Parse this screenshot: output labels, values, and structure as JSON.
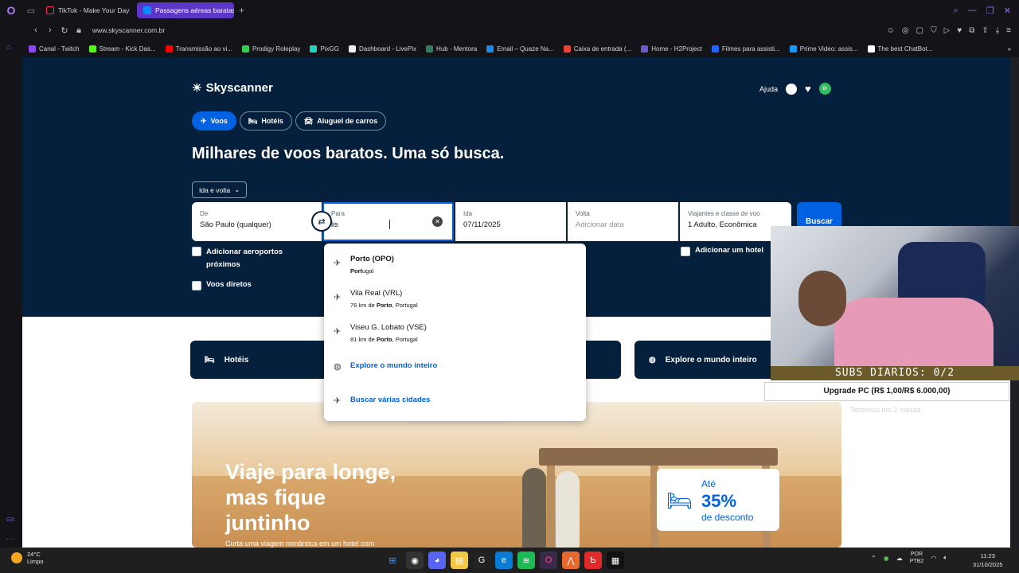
{
  "browser": {
    "tabs": [
      {
        "label": "TikTok - Make Your Day",
        "active": false
      },
      {
        "label": "Passagens aéreas baratas",
        "active": true
      }
    ],
    "url": "www.skyscanner.com.br",
    "bookmarks": [
      {
        "label": "Canal - Twitch",
        "color": "#9146ff"
      },
      {
        "label": "Stream - Kick Das...",
        "color": "#53fc18"
      },
      {
        "label": "Transmissão ao vi...",
        "color": "#ff0000"
      },
      {
        "label": "Prodigy Roleplay",
        "color": "#33cc55"
      },
      {
        "label": "PixGG",
        "color": "#22d3c5"
      },
      {
        "label": "Dashboard - LivePix",
        "color": "#eeeeee"
      },
      {
        "label": "Hub - Mentora",
        "color": "#2e7d5b"
      },
      {
        "label": "Email – Quaze Na...",
        "color": "#1e88e5"
      },
      {
        "label": "Caixa de entrada (...",
        "color": "#ea4335"
      },
      {
        "label": "Home - H2Project",
        "color": "#6a5acd"
      },
      {
        "label": "Filmes para assisti...",
        "color": "#1e66ff"
      },
      {
        "label": "Prime Video: assis...",
        "color": "#1a98ff"
      },
      {
        "label": "The best ChatBot...",
        "color": "#ffffff"
      }
    ]
  },
  "site": {
    "logo": "Skyscanner",
    "help": "Ajuda",
    "avatar_initials": "BI",
    "nav": [
      {
        "label": "Voos",
        "icon": "plane-icon",
        "active": true
      },
      {
        "label": "Hotéis",
        "icon": "bed-icon",
        "active": false
      },
      {
        "label": "Aluguel de carros",
        "icon": "car-icon",
        "active": false
      }
    ],
    "headline": "Milhares de voos baratos. Uma só busca.",
    "trip_type": "Ida e volta",
    "search": {
      "from_label": "De",
      "from_value": "São Paulo (qualquer)",
      "to_label": "Para",
      "to_value": "lis",
      "depart_label": "Ida",
      "depart_value": "07/11/2025",
      "return_label": "Volta",
      "return_placeholder": "Adicionar data",
      "travelers_label": "Viajantes e classe de voo",
      "travelers_value": "1 Adulto, Econômica",
      "search_button": "Buscar"
    },
    "checkboxes": {
      "nearby_airports": "Adicionar aeroportos próximos",
      "direct_flights": "Voos diretos",
      "add_hotel": "Adicionar um hotel"
    },
    "dropdown": [
      {
        "name": "Porto (OPO)",
        "sub_prefix": "",
        "sub_bold": "Port",
        "sub_rest": "ugal"
      },
      {
        "name": "Vila Real (VRL)",
        "sub_prefix": "76 km de ",
        "sub_bold": "Porto",
        "sub_rest": ", Portugal"
      },
      {
        "name": "Viseu G. Lobato (VSE)",
        "sub_prefix": "81 km de ",
        "sub_bold": "Porto",
        "sub_rest": ", Portugal"
      }
    ],
    "dropdown_links": {
      "explore": "Explore o mundo inteiro",
      "multi_city": "Buscar várias cidades"
    },
    "cards": {
      "hotels": "Hotéis",
      "explore": "Explore o mundo inteiro"
    },
    "promo": {
      "title_line1": "Viaje para longe,",
      "title_line2": "mas fique",
      "title_line3": "juntinho",
      "subtitle": "Curta uma viagem romântica em um hotel com",
      "badge_prefix": "Até",
      "badge_percent": "35%",
      "badge_suffix": "de desconto"
    }
  },
  "overlay": {
    "subs": "SUBS DIARIOS: 0/2",
    "goal": "Upgrade PC (R$ 1,00/R$ 6.000,00)",
    "tentativa": "Terminou em 2 meses"
  },
  "taskbar": {
    "weather_temp": "24°C",
    "weather_desc": "Limpo",
    "lang_line1": "POR",
    "lang_line2": "PTB2",
    "time": "11:23",
    "date": "31/10/2025"
  }
}
